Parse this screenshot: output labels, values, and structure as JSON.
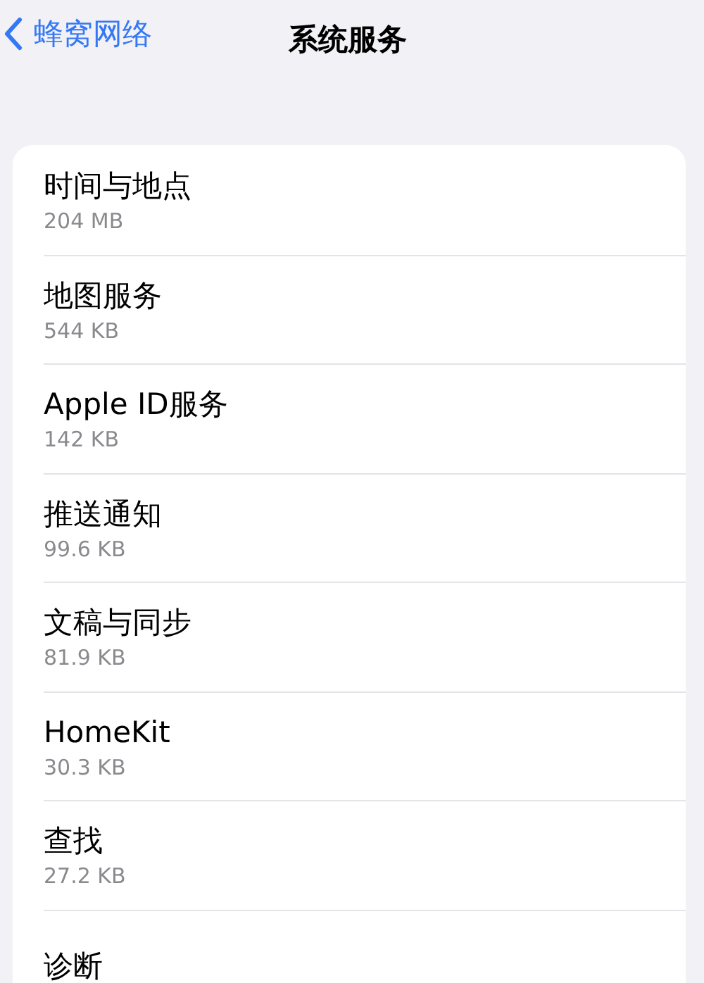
{
  "nav": {
    "back_label": "蜂窝网络",
    "title": "系统服务"
  },
  "items": [
    {
      "title": "时间与地点",
      "size": "204 MB"
    },
    {
      "title": "地图服务",
      "size": "544 KB"
    },
    {
      "title": "Apple ID服务",
      "size": "142 KB"
    },
    {
      "title": "推送通知",
      "size": "99.6 KB"
    },
    {
      "title": "文稿与同步",
      "size": "81.9 KB"
    },
    {
      "title": "HomeKit",
      "size": "30.3 KB"
    },
    {
      "title": "查找",
      "size": "27.2 KB"
    },
    {
      "title": "诊断"
    }
  ]
}
